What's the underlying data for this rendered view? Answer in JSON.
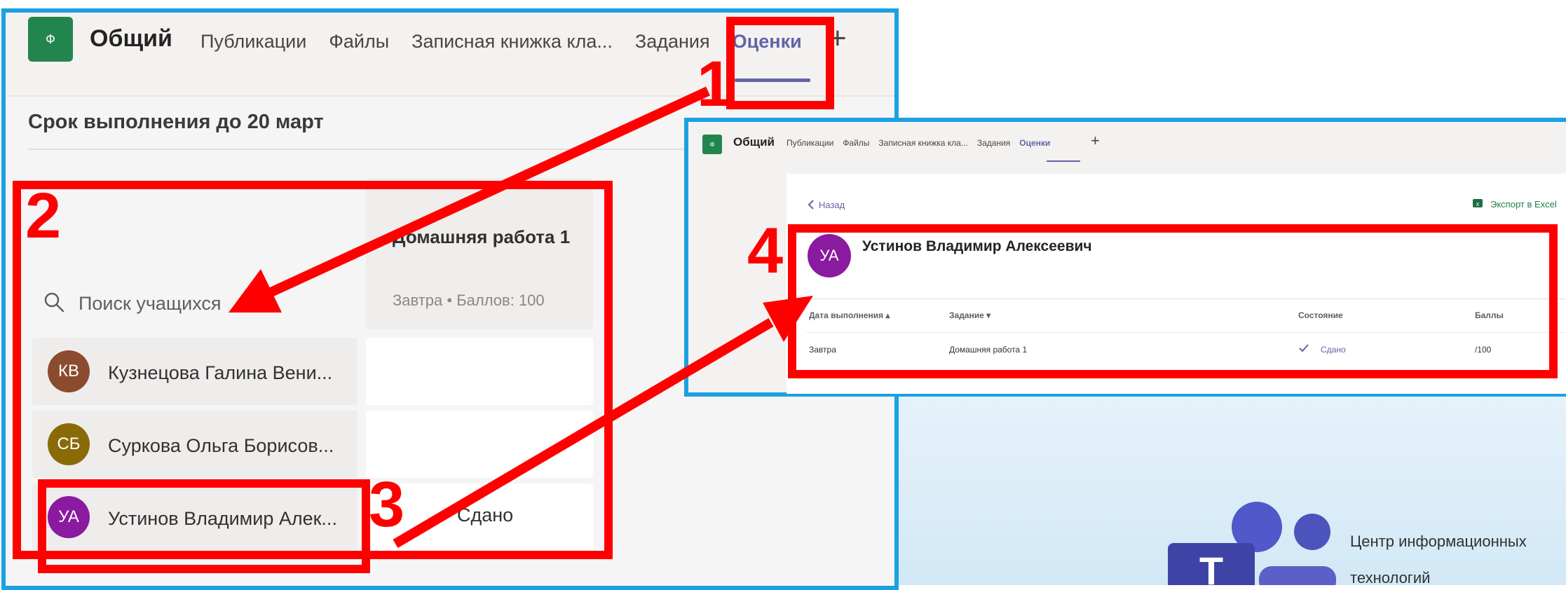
{
  "left_window": {
    "team_icon_letter": "Ф",
    "team_name": "Общий",
    "tabs": [
      {
        "label": "Публикации",
        "active": false
      },
      {
        "label": "Файлы",
        "active": false
      },
      {
        "label": "Записная книжка кла...",
        "active": false
      },
      {
        "label": "Задания",
        "active": false
      },
      {
        "label": "Оценки",
        "active": true
      }
    ],
    "add_tab": "+",
    "deadline": "Срок выполнения до 20 март",
    "search_placeholder": "Поиск учащихся",
    "assignment": {
      "name": "Домашняя работа 1",
      "meta": "Завтра • Баллов: 100"
    },
    "students": [
      {
        "initials": "КВ",
        "name": "Кузнецова Галина Вени...",
        "color": "#8b4b2e",
        "grade": ""
      },
      {
        "initials": "СБ",
        "name": "Суркова Ольга Борисов...",
        "color": "#8a6a07",
        "grade": ""
      },
      {
        "initials": "УА",
        "name": "Устинов Владимир Алек...",
        "color": "#8a1aa0",
        "grade": "Сдано"
      }
    ]
  },
  "right_window": {
    "team_icon_letter": "Ф",
    "team_name": "Общий",
    "tabs": [
      {
        "label": "Публикации",
        "active": false
      },
      {
        "label": "Файлы",
        "active": false
      },
      {
        "label": "Записная книжка кла...",
        "active": false
      },
      {
        "label": "Задания",
        "active": false
      },
      {
        "label": "Оценки",
        "active": true
      }
    ],
    "add_tab": "+",
    "back_label": "Назад",
    "export_label": "Экспорт в Excel",
    "student": {
      "initials": "УА",
      "name": "Устинов Владимир Алексеевич",
      "color": "#8a1aa0"
    },
    "table": {
      "headers": [
        "Дата выполнения ▴",
        "Задание ▾",
        "Состояние",
        "Баллы"
      ],
      "rows": [
        {
          "due": "Завтра",
          "assignment": "Домашняя работа 1",
          "status": "Сдано",
          "points": "/100"
        }
      ]
    }
  },
  "annotations": {
    "labels": [
      "1",
      "2",
      "3",
      "4"
    ],
    "color": "#ff0000"
  },
  "logo": {
    "caption_line1": "Центр информационных",
    "caption_line2": "технологий"
  },
  "colors": {
    "window_border": "#1ba1e2",
    "teams_purple": "#6264a7",
    "team_green": "#23854e"
  }
}
